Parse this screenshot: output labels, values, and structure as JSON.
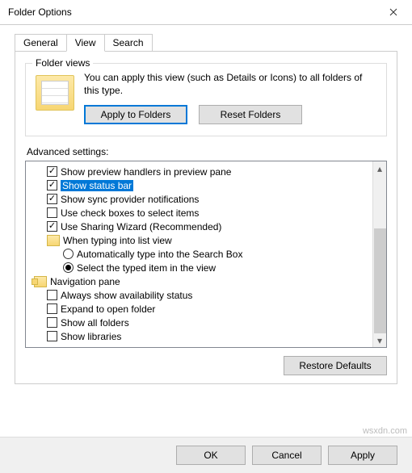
{
  "title": "Folder Options",
  "tabs": {
    "general": "General",
    "view": "View",
    "search": "Search"
  },
  "folderViews": {
    "group": "Folder views",
    "text": "You can apply this view (such as Details or Icons) to all folders of this type.",
    "applyBtn": "Apply to Folders",
    "resetBtn": "Reset Folders"
  },
  "advLabel": "Advanced settings:",
  "items": {
    "previewHandlers": "Show preview handlers in preview pane",
    "statusBar": "Show status bar",
    "syncProvider": "Show sync provider notifications",
    "checkBoxes": "Use check boxes to select items",
    "sharingWizard": "Use Sharing Wizard (Recommended)",
    "typingGroup": "When typing into list view",
    "autoType": "Automatically type into the Search Box",
    "selectTyped": "Select the typed item in the view",
    "navPane": "Navigation pane",
    "alwaysAvail": "Always show availability status",
    "expandOpen": "Expand to open folder",
    "showAllFolders": "Show all folders",
    "showLibraries": "Show libraries"
  },
  "restoreBtn": "Restore Defaults",
  "footer": {
    "ok": "OK",
    "cancel": "Cancel",
    "apply": "Apply"
  },
  "watermark": "wsxdn.com"
}
